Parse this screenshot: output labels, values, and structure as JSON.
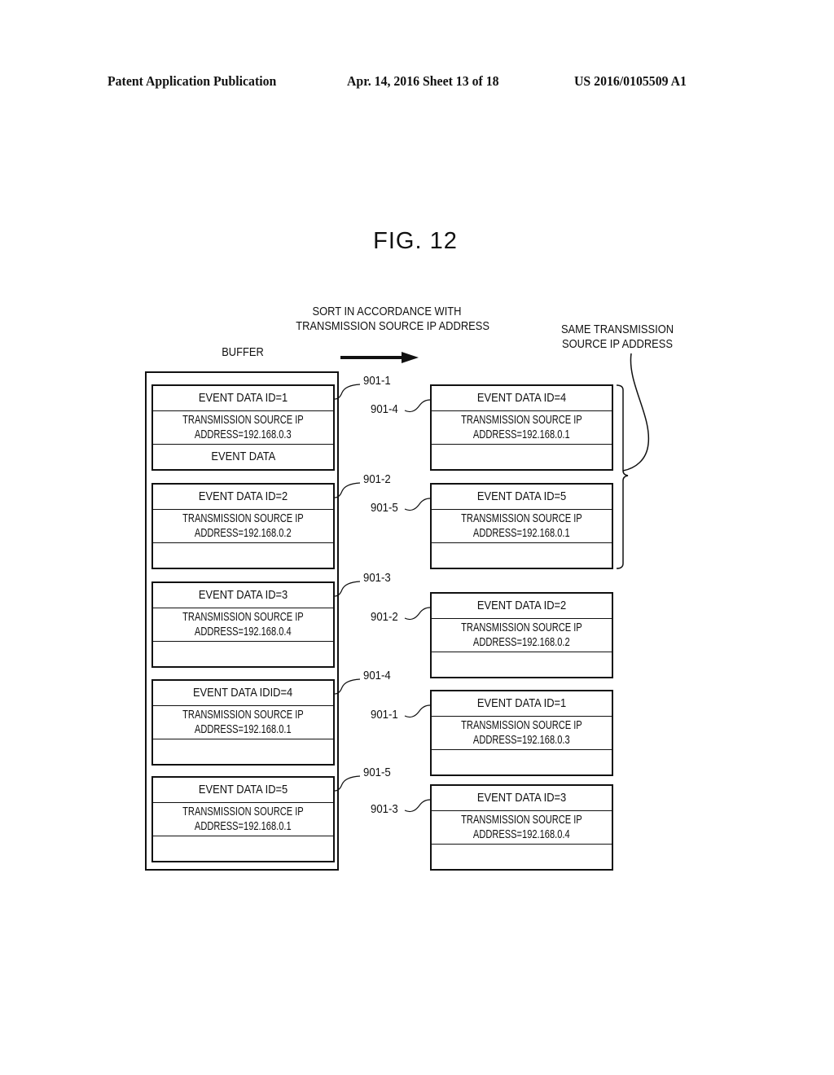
{
  "header": {
    "publication": "Patent Application Publication",
    "date_sheet": "Apr. 14, 2016  Sheet 13 of 18",
    "number": "US 2016/0105509 A1"
  },
  "figure_title": "FIG. 12",
  "labels": {
    "sort_line1": "SORT IN ACCORDANCE WITH",
    "sort_line2": "TRANSMISSION SOURCE IP ADDRESS",
    "buffer": "BUFFER",
    "same_line1": "SAME TRANSMISSION",
    "same_line2": "SOURCE IP ADDRESS"
  },
  "buffer_records": [
    {
      "ref": "901-1",
      "id_label": "EVENT DATA ID=1",
      "ip_line1": "TRANSMISSION SOURCE IP",
      "ip_line2": "ADDRESS=192.168.0.3",
      "data": "EVENT DATA"
    },
    {
      "ref": "901-2",
      "id_label": "EVENT DATA ID=2",
      "ip_line1": "TRANSMISSION SOURCE IP",
      "ip_line2": "ADDRESS=192.168.0.2",
      "data": ""
    },
    {
      "ref": "901-3",
      "id_label": "EVENT DATA ID=3",
      "ip_line1": "TRANSMISSION SOURCE IP",
      "ip_line2": "ADDRESS=192.168.0.4",
      "data": ""
    },
    {
      "ref": "901-4",
      "id_label": "EVENT DATA IDID=4",
      "ip_line1": "TRANSMISSION SOURCE IP",
      "ip_line2": "ADDRESS=192.168.0.1",
      "data": ""
    },
    {
      "ref": "901-5",
      "id_label": "EVENT DATA ID=5",
      "ip_line1": "TRANSMISSION SOURCE IP",
      "ip_line2": "ADDRESS=192.168.0.1",
      "data": ""
    }
  ],
  "sorted_records": [
    {
      "ref": "901-4",
      "id_label": "EVENT DATA ID=4",
      "ip_line1": "TRANSMISSION SOURCE IP",
      "ip_line2": "ADDRESS=192.168.0.1",
      "data": ""
    },
    {
      "ref": "901-5",
      "id_label": "EVENT DATA ID=5",
      "ip_line1": "TRANSMISSION SOURCE IP",
      "ip_line2": "ADDRESS=192.168.0.1",
      "data": ""
    },
    {
      "ref": "901-2",
      "id_label": "EVENT DATA ID=2",
      "ip_line1": "TRANSMISSION SOURCE IP",
      "ip_line2": "ADDRESS=192.168.0.2",
      "data": ""
    },
    {
      "ref": "901-1",
      "id_label": "EVENT DATA ID=1",
      "ip_line1": "TRANSMISSION SOURCE IP",
      "ip_line2": "ADDRESS=192.168.0.3",
      "data": ""
    },
    {
      "ref": "901-3",
      "id_label": "EVENT DATA ID=3",
      "ip_line1": "TRANSMISSION SOURCE IP",
      "ip_line2": "ADDRESS=192.168.0.4",
      "data": ""
    }
  ]
}
